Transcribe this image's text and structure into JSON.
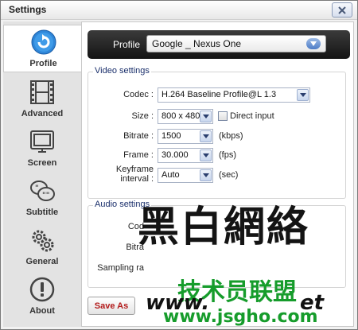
{
  "window": {
    "title": "Settings"
  },
  "sidebar": {
    "items": [
      {
        "label": "Profile",
        "icon": "profile-refresh-icon"
      },
      {
        "label": "Advanced",
        "icon": "film-strip-icon"
      },
      {
        "label": "Screen",
        "icon": "monitor-icon"
      },
      {
        "label": "Subtitle",
        "icon": "speech-bubble-icon"
      },
      {
        "label": "General",
        "icon": "gear-icon"
      },
      {
        "label": "About",
        "icon": "exclamation-icon"
      }
    ]
  },
  "profile": {
    "label": "Profile",
    "value": "Google _ Nexus One"
  },
  "video": {
    "title": "Video settings",
    "codec_label": "Codec :",
    "codec_value": "H.264 Baseline Profile@L 1.3",
    "size_label": "Size :",
    "size_value": "800 x 480",
    "direct_input_label": "Direct input",
    "bitrate_label": "Bitrate :",
    "bitrate_value": "1500",
    "bitrate_unit": "(kbps)",
    "frame_label": "Frame :",
    "frame_value": "30.000",
    "frame_unit": "(fps)",
    "keyframe_label_1": "Keyframe",
    "keyframe_label_2": "interval :",
    "keyframe_value": "Auto",
    "keyframe_unit": "(sec)"
  },
  "audio": {
    "title": "Audio settings",
    "codec_label": "Cod",
    "bitrate_label": "Bitra",
    "sampling_label": "Sampling ra"
  },
  "actions": {
    "save_as": "Save As"
  },
  "watermark": {
    "big": "黑白網絡",
    "green": "技术员联盟",
    "url": "www.",
    "url_tail": "et",
    "url2": "www.jsgho.com"
  },
  "colors": {
    "accent": "#1a2f6b",
    "save_text": "#b31b1b",
    "watermark_green": "#169c2b"
  }
}
